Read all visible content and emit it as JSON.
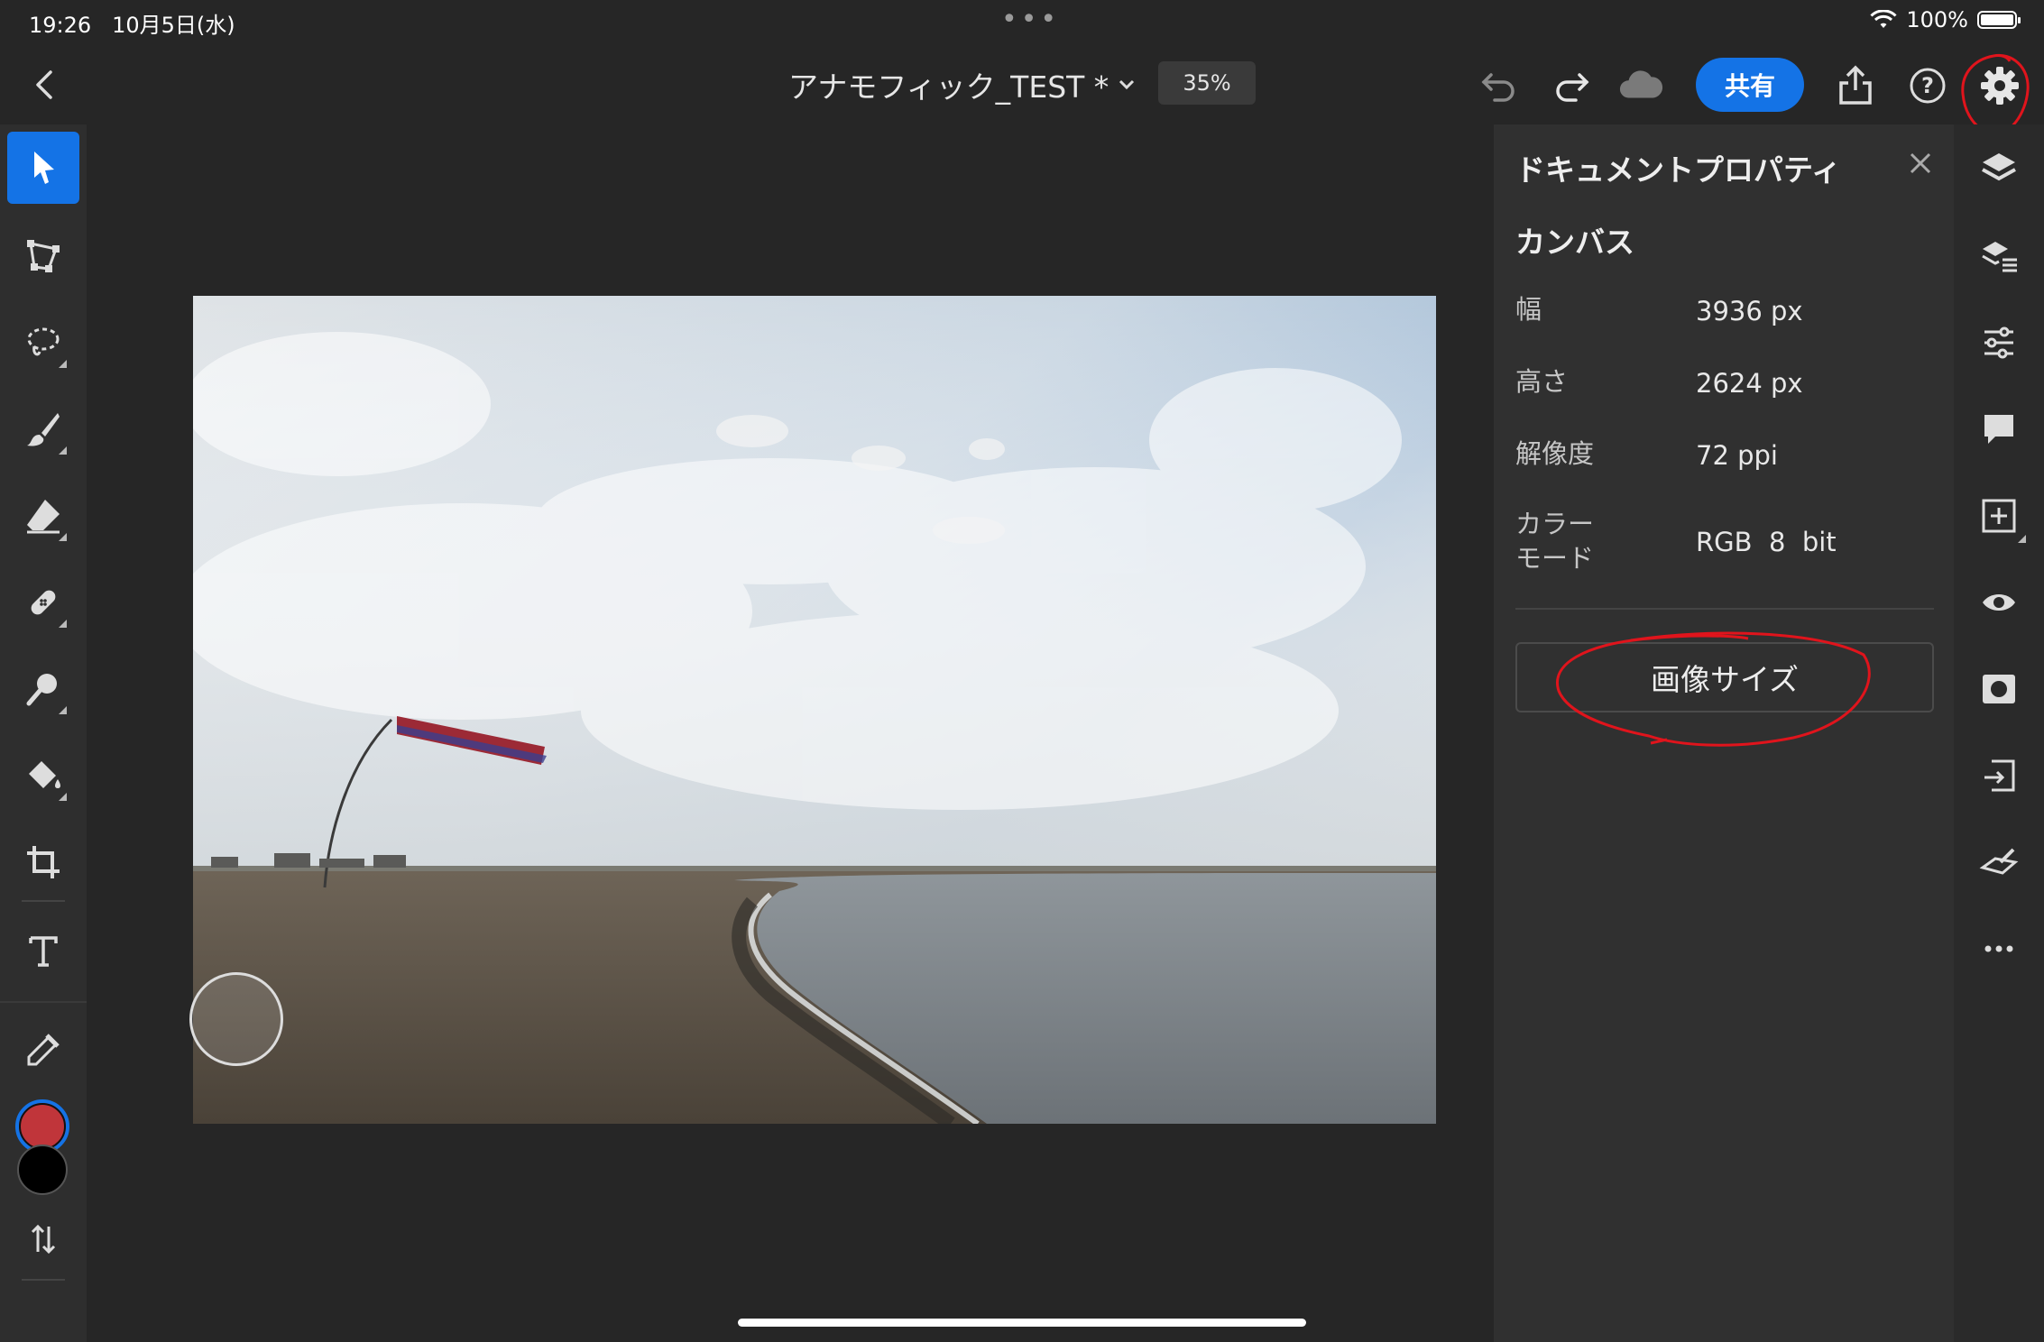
{
  "status_bar": {
    "time": "19:26",
    "date": "10月5日(水)",
    "battery": "100%",
    "dots": "•••"
  },
  "topbar": {
    "document_title": "アナモフィック_TEST *",
    "zoom": "35%",
    "share_label": "共有"
  },
  "left_tools": [
    "select-tool",
    "transform-tool",
    "lasso-tool",
    "brush-tool",
    "eraser-tool",
    "healing-tool",
    "smudge-tool",
    "fill-tool",
    "crop-tool",
    "type-tool",
    "eyedropper-tool",
    "swap-colors-tool"
  ],
  "colors": {
    "accent": "#1473e6",
    "foreground_color": "#c0353a",
    "background_color": "#000000",
    "annotation_red": "#e0141c"
  },
  "panel": {
    "title": "ドキュメントプロパティ",
    "section": "カンバス",
    "properties": [
      {
        "label": "幅",
        "value": "3936 px"
      },
      {
        "label": "高さ",
        "value": "2624 px"
      },
      {
        "label": "解像度",
        "value": "72 ppi"
      },
      {
        "label": "カラー\nモード",
        "value": "RGB  8  bit"
      }
    ],
    "image_size_button": "画像サイズ"
  },
  "right_icons": [
    "layers-icon",
    "layer-properties-icon",
    "adjustments-icon",
    "comments-icon",
    "add-layer-icon",
    "visibility-icon",
    "mask-icon",
    "import-icon",
    "clear-icon",
    "more-icon"
  ]
}
